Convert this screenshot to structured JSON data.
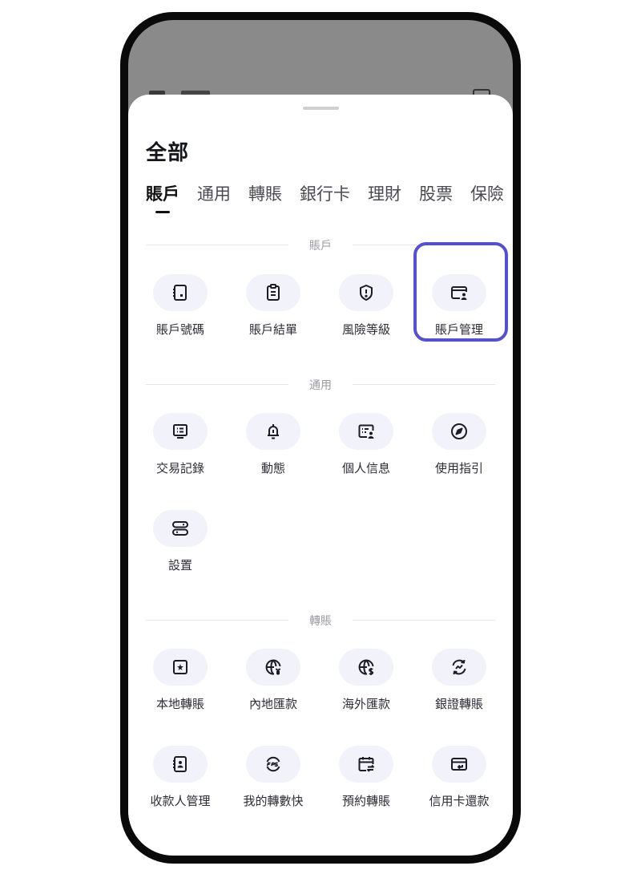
{
  "sheet": {
    "title": "全部"
  },
  "tabs": [
    "賬戶",
    "通用",
    "轉賬",
    "銀行卡",
    "理財",
    "股票",
    "保險"
  ],
  "sections": {
    "account": {
      "label": "賬戶",
      "items": [
        {
          "label": "賬戶號碼",
          "icon": "account-number-icon"
        },
        {
          "label": "賬戶結單",
          "icon": "statement-icon"
        },
        {
          "label": "風險等級",
          "icon": "risk-shield-icon"
        },
        {
          "label": "賬戶管理",
          "icon": "account-management-icon"
        }
      ]
    },
    "general": {
      "label": "通用",
      "items": [
        {
          "label": "交易記錄",
          "icon": "transaction-record-icon"
        },
        {
          "label": "動態",
          "icon": "bell-icon"
        },
        {
          "label": "個人信息",
          "icon": "personal-info-icon"
        },
        {
          "label": "使用指引",
          "icon": "compass-icon"
        },
        {
          "label": "設置",
          "icon": "settings-icon"
        }
      ]
    },
    "transfer": {
      "label": "轉賬",
      "items": [
        {
          "label": "本地轉賬",
          "icon": "local-transfer-icon"
        },
        {
          "label": "內地匯款",
          "icon": "mainland-remittance-icon"
        },
        {
          "label": "海外匯款",
          "icon": "overseas-remittance-icon"
        },
        {
          "label": "銀證轉賬",
          "icon": "bank-securities-transfer-icon"
        },
        {
          "label": "收款人管理",
          "icon": "payee-management-icon"
        },
        {
          "label": "我的轉數快",
          "icon": "fps-icon"
        },
        {
          "label": "預約轉賬",
          "icon": "scheduled-transfer-icon"
        },
        {
          "label": "信用卡還款",
          "icon": "credit-card-repayment-icon"
        }
      ]
    }
  },
  "colors": {
    "highlight": "#5551c8",
    "pill": "#f2f3fa",
    "text": "#2d2d35"
  }
}
